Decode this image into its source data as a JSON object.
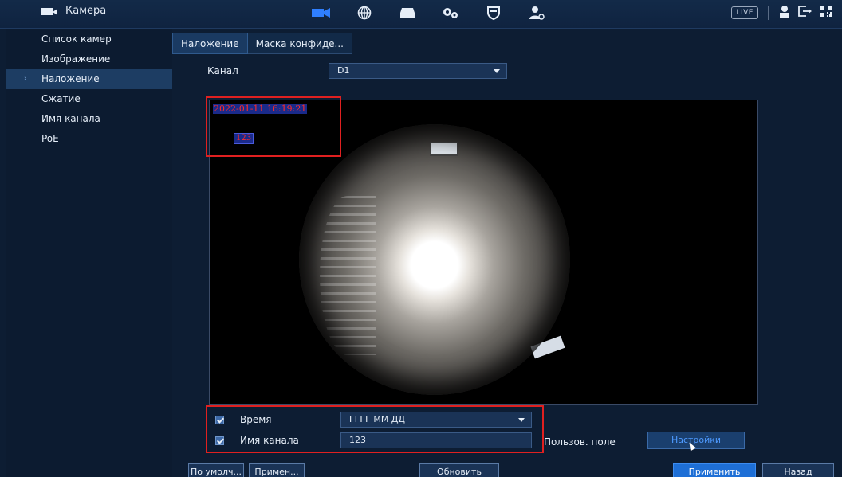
{
  "app": {
    "section_title": "Камера",
    "top_icons": [
      "camera-icon",
      "network-icon",
      "storage-icon",
      "settings-icon",
      "security-icon",
      "account-icon"
    ],
    "live_label": "LIVE",
    "right_icons": [
      "user-icon",
      "logout-icon",
      "qr-icon"
    ]
  },
  "sidebar": {
    "items": [
      {
        "label": "Список камер",
        "active": false
      },
      {
        "label": "Изображение",
        "active": false
      },
      {
        "label": "Наложение",
        "active": true
      },
      {
        "label": "Сжатие",
        "active": false
      },
      {
        "label": "Имя канала",
        "active": false
      },
      {
        "label": "PoE",
        "active": false
      }
    ]
  },
  "tabs": [
    {
      "label": "Наложение",
      "active": true
    },
    {
      "label": "Маска конфиде...",
      "active": false
    }
  ],
  "channel": {
    "label": "Канал",
    "value": "D1"
  },
  "preview": {
    "osd_time": "2022-01-11 16:19:21",
    "osd_name": "123"
  },
  "options": {
    "time_label": "Время",
    "time_format": "ГГГГ ММ ДД",
    "channel_name_label": "Имя канала",
    "channel_name_value": "123",
    "user_field_label": "Пользов. поле",
    "settings_button": "Настройки"
  },
  "buttons": {
    "default": "По умолч...",
    "apply_to": "Примен...",
    "refresh": "Обновить",
    "apply": "Применить",
    "back": "Назад"
  },
  "colors": {
    "accent": "#1e6fd6",
    "highlight": "#e02020",
    "osd_text": "#ff2a2a"
  }
}
